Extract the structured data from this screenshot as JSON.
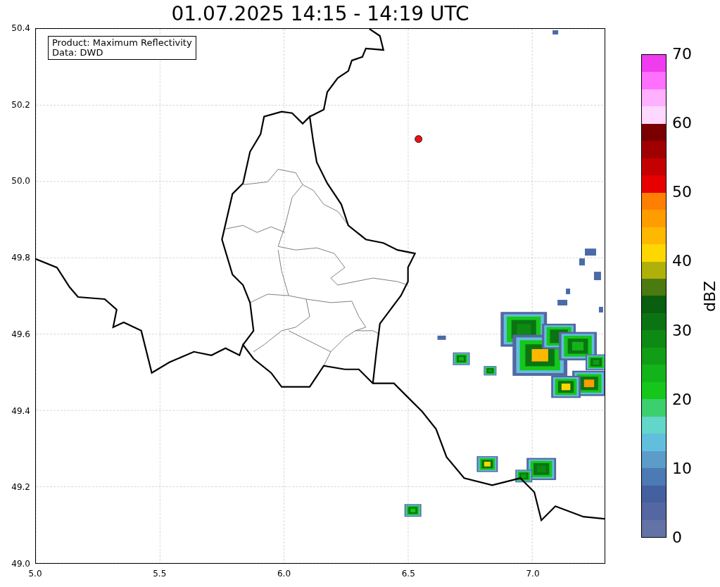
{
  "title": "01.07.2025 14:15 - 14:19 UTC",
  "info_box": {
    "lines": [
      "Product: Maximum Reflectivity",
      "Data: DWD"
    ]
  },
  "x_ticks": [
    "5.0",
    "5.5",
    "6.0",
    "6.5",
    "7.0"
  ],
  "y_ticks": [
    "50.4",
    "50.2",
    "50.0",
    "49.8",
    "49.6",
    "49.4",
    "49.2",
    "49.0"
  ],
  "colorbar": {
    "label": "dBZ",
    "ticks": [
      "70",
      "60",
      "50",
      "40",
      "30",
      "20",
      "10",
      "0"
    ],
    "segments": [
      {
        "color": "#6373a6"
      },
      {
        "color": "#5567a2"
      },
      {
        "color": "#44609f"
      },
      {
        "color": "#4b7ab4"
      },
      {
        "color": "#5b9dc8"
      },
      {
        "color": "#62bedd"
      },
      {
        "color": "#62d6c8"
      },
      {
        "color": "#3ccf6e"
      },
      {
        "color": "#15c71b"
      },
      {
        "color": "#13b41a"
      },
      {
        "color": "#0f9e16"
      },
      {
        "color": "#0d8a14"
      },
      {
        "color": "#0b7412"
      },
      {
        "color": "#095e10"
      },
      {
        "color": "#4a7a10"
      },
      {
        "color": "#b0b00a"
      },
      {
        "color": "#ffd700"
      },
      {
        "color": "#ffb800"
      },
      {
        "color": "#ff9d00"
      },
      {
        "color": "#ff7f00"
      },
      {
        "color": "#e60000"
      },
      {
        "color": "#c40000"
      },
      {
        "color": "#a00000"
      },
      {
        "color": "#7a0000"
      },
      {
        "color": "#ffd8ff"
      },
      {
        "color": "#ffb0ff"
      },
      {
        "color": "#ff70ff"
      },
      {
        "color": "#ee3cee"
      }
    ]
  }
}
